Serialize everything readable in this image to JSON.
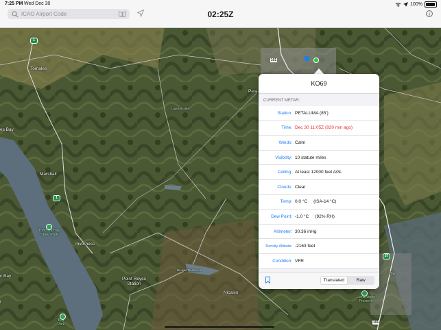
{
  "status_bar": {
    "time": "7:25 PM",
    "date": "Wed Dec 30",
    "battery": "100%"
  },
  "toolbar": {
    "search_placeholder": "ICAO Airport Code",
    "clock": "02:25Z"
  },
  "map": {
    "labels": {
      "tomales": "Tomales",
      "petaluma": "Peta",
      "bay": "es Bay",
      "marshall": "Marshall",
      "tomales_bay_state_park": "Tomales Bay\nState Park",
      "inverness": "Inverness",
      "point_reyes": "Point Reyes\nStation",
      "nicasio": "Nicasio",
      "nicasio_reservoir": "Nicasio Reservoir",
      "laguna_lake": "Laguna Lake",
      "loma_verde": "Loma Verde\nPreserve",
      "bayland": "Bay",
      "tomales_bay_left": "es Bay",
      "left_edge": "c Bay",
      "left_edge_lower": "es Bay",
      "left_edge_bottom": "t",
      "lower_left": "Bay\nPark"
    },
    "shields": {
      "sr1_top": "1",
      "sr1_mid": "1",
      "us101_top": "101",
      "us101_bottom": "101",
      "sr37": "37"
    }
  },
  "metar_popup": {
    "title": "KO69",
    "section_header": "CURRENT METAR:",
    "rows": [
      {
        "key": "Station:",
        "value": "PETALUMA (85')",
        "highlight": false
      },
      {
        "key": "Time:",
        "value": "Dec 30 11:05Z (920 min ago)",
        "highlight": true
      },
      {
        "key": "Winds:",
        "value": "Calm",
        "highlight": false
      },
      {
        "key": "Visibility:",
        "value": "10 statute miles",
        "highlight": false
      },
      {
        "key": "Ceiling:",
        "value": "At least 12000 feet AGL",
        "highlight": false
      },
      {
        "key": "Clouds:",
        "value": "Clear",
        "highlight": false
      },
      {
        "key": "Temp:",
        "value": "0.0 °C     (ISA-14 °C)",
        "highlight": false
      },
      {
        "key": "Dew Point:",
        "value": "-1.0 °C     (92% RH)",
        "highlight": false
      },
      {
        "key": "Altimeter:",
        "value": "30.36 inHg",
        "highlight": false
      },
      {
        "key": "Density Altitude:",
        "value": "-2163 feet",
        "highlight": false
      },
      {
        "key": "Condition:",
        "value": "VFR",
        "highlight": false
      }
    ],
    "segments": {
      "translated": "Translated",
      "raw": "Raw",
      "selected": "Translated"
    }
  }
}
